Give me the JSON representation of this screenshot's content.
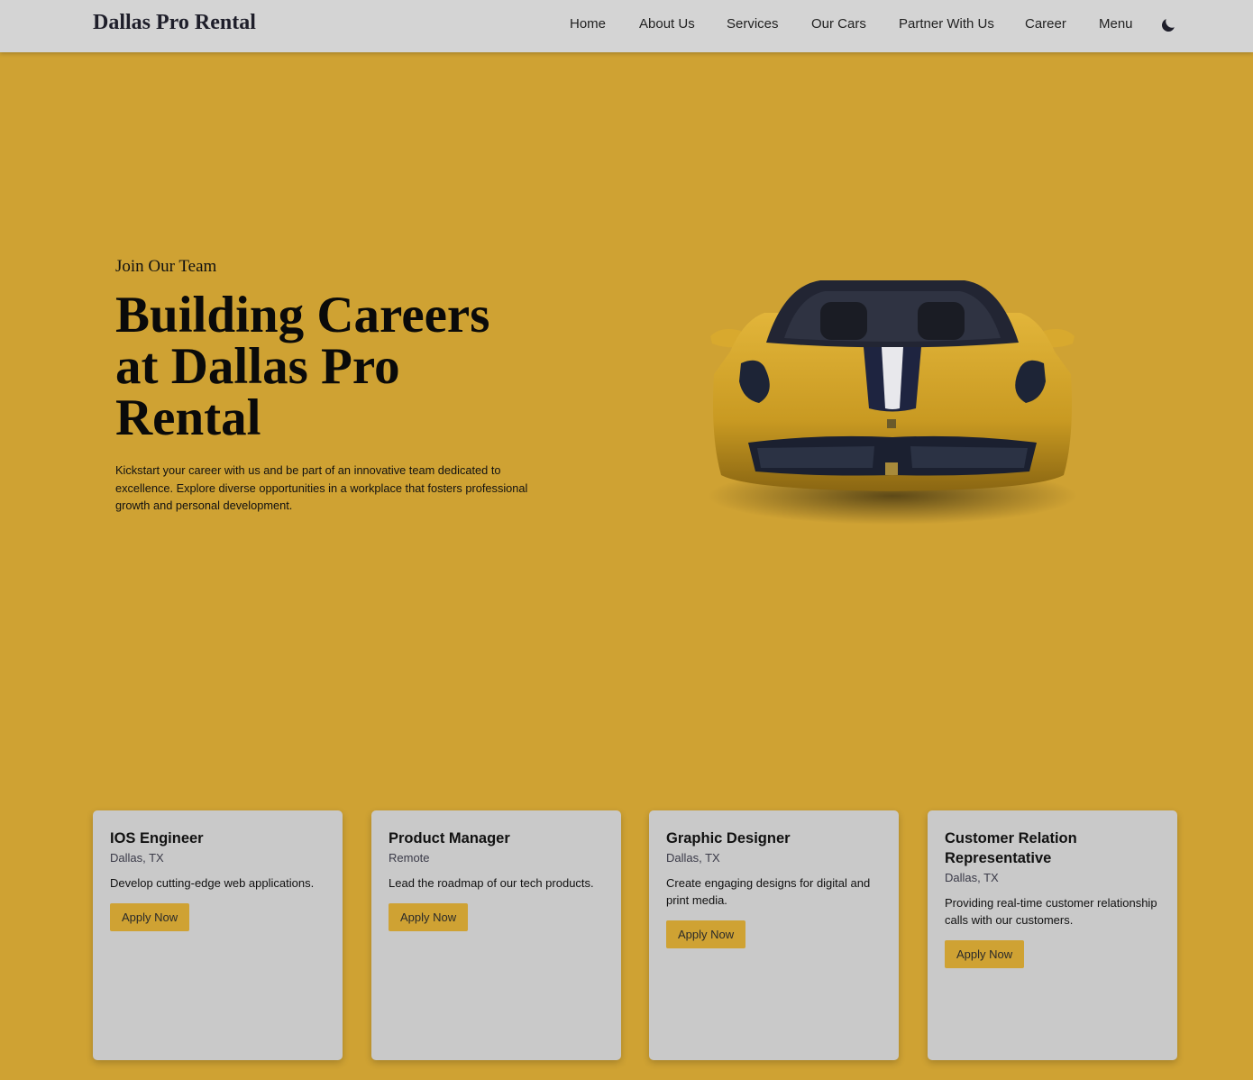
{
  "nav": {
    "brand": "Dallas Pro Rental",
    "links": [
      "Home",
      "About Us",
      "Services",
      "Our Cars",
      "Partner With Us",
      "Career",
      "Menu"
    ],
    "theme_toggle_icon": "moon-icon"
  },
  "hero": {
    "eyebrow": "Join Our Team",
    "title": "Building Careers at Dallas Pro Rental",
    "description": "Kickstart your career with us and be part of an innovative team dedicated to excellence. Explore diverse opportunities in a workplace that fosters professional growth and personal development."
  },
  "jobs": [
    {
      "title": "IOS Engineer",
      "location": "Dallas, TX",
      "description": "Develop cutting-edge web applications.",
      "button": "Apply Now"
    },
    {
      "title": "Product Manager",
      "location": "Remote",
      "description": "Lead the roadmap of our tech products.",
      "button": "Apply Now"
    },
    {
      "title": "Graphic Designer",
      "location": "Dallas, TX",
      "description": "Create engaging designs for digital and print media.",
      "button": "Apply Now"
    },
    {
      "title": "Customer Relation Representative",
      "location": "Dallas, TX",
      "description": "Providing real-time customer relationship calls with our customers.",
      "button": "Apply Now"
    }
  ],
  "colors": {
    "background": "#cfa233",
    "navbar": "#d4d4d4",
    "card": "#c9c9c9",
    "button": "#cfa233"
  }
}
